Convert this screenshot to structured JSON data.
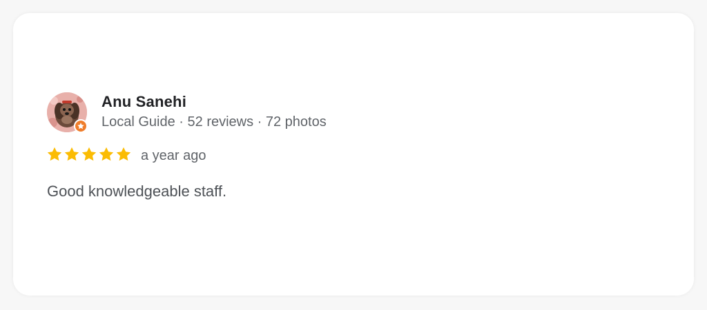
{
  "review": {
    "reviewer_name": "Anu Sanehi",
    "reviewer_meta": "Local Guide · 52 reviews · 72 photos",
    "rating": 5,
    "rating_max": 5,
    "time_ago": "a year ago",
    "text": "Good knowledgeable staff."
  },
  "colors": {
    "star": "#fbbc04",
    "badge": "#ef7d2b",
    "name": "#202124",
    "meta": "#5f6368"
  },
  "icons": {
    "avatar": "reviewer-photo",
    "badge": "local-guide-star-icon",
    "rating": "star-icon"
  }
}
